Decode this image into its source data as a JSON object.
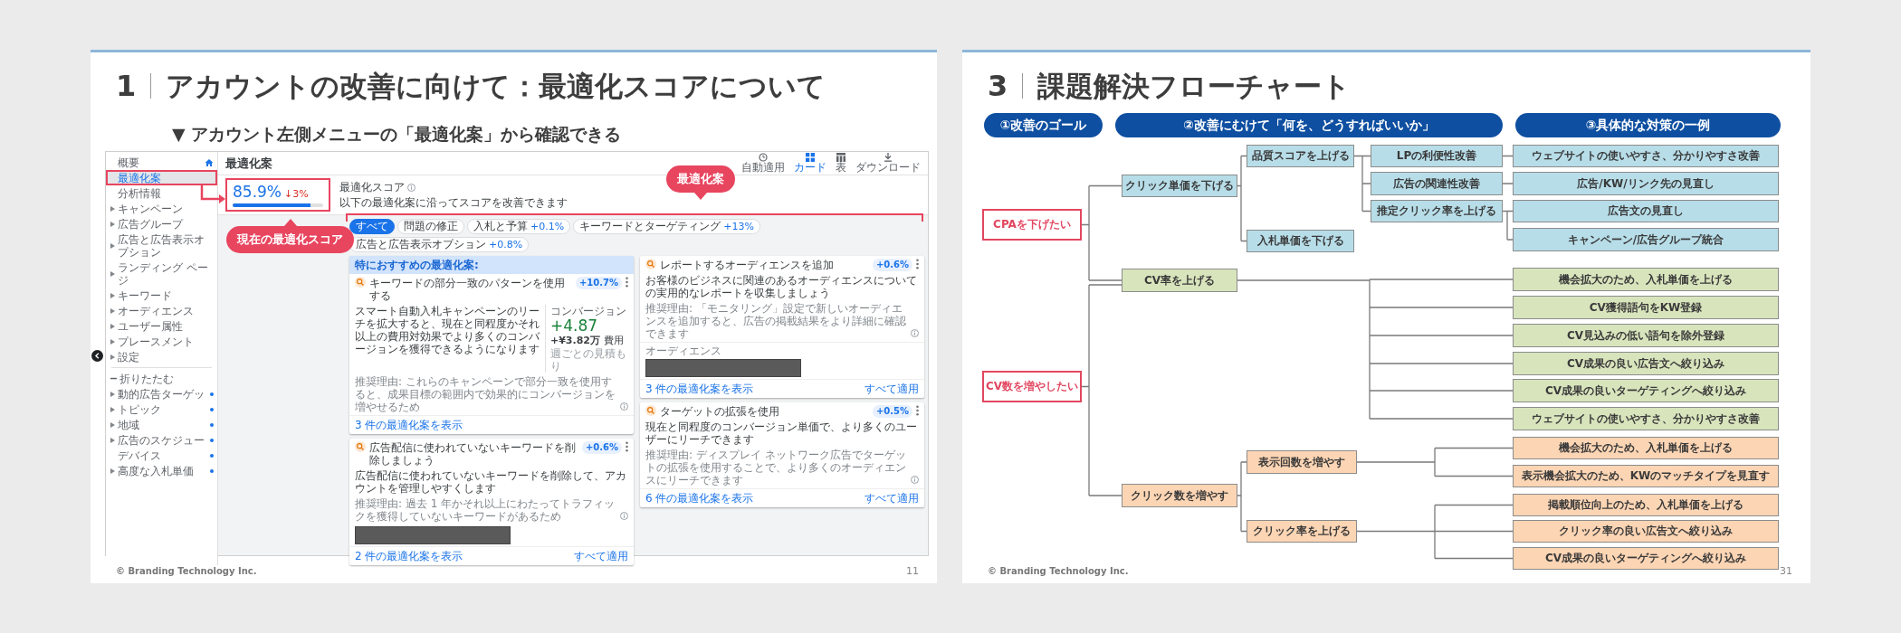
{
  "slides": [
    {
      "kind": "screenshot",
      "number": "1",
      "title": "アカウントの改善に向けて：最適化スコアについて",
      "subtitle": "▼ アカウント左側メニューの「最適化案」から確認できる",
      "screen": {
        "sidebar": [
          {
            "kind": "link",
            "label": "概要",
            "selected": false,
            "expandable": false,
            "flagged": false
          },
          {
            "kind": "link",
            "label": "最適化案",
            "selected": true,
            "expandable": false,
            "flagged": false
          },
          {
            "kind": "link",
            "label": "分析情報",
            "selected": false,
            "expandable": false,
            "flagged": false
          },
          {
            "kind": "link",
            "label": "キャンペーン",
            "selected": false,
            "expandable": true,
            "flagged": false
          },
          {
            "kind": "link",
            "label": "広告グループ",
            "selected": false,
            "expandable": true,
            "flagged": false
          },
          {
            "kind": "link",
            "label": "広告と広告表示オプション",
            "selected": false,
            "expandable": true,
            "flagged": false
          },
          {
            "kind": "link",
            "label": "ランディング ページ",
            "selected": false,
            "expandable": true,
            "flagged": false
          },
          {
            "kind": "link",
            "label": "キーワード",
            "selected": false,
            "expandable": true,
            "flagged": false
          },
          {
            "kind": "link",
            "label": "オーディエンス",
            "selected": false,
            "expandable": true,
            "flagged": false
          },
          {
            "kind": "link",
            "label": "ユーザー属性",
            "selected": false,
            "expandable": true,
            "flagged": false
          },
          {
            "kind": "link",
            "label": "プレースメント",
            "selected": false,
            "expandable": true,
            "flagged": false
          },
          {
            "kind": "link",
            "label": "設定",
            "selected": false,
            "expandable": true,
            "flagged": false
          },
          {
            "kind": "collapse",
            "label": "折りたたむ",
            "selected": false
          },
          {
            "kind": "link",
            "label": "動的広告ターゲッ",
            "selected": false,
            "expandable": true,
            "flagged": true
          },
          {
            "kind": "link",
            "label": "トピック",
            "selected": false,
            "expandable": true,
            "flagged": true
          },
          {
            "kind": "link",
            "label": "地域",
            "selected": false,
            "expandable": true,
            "flagged": true
          },
          {
            "kind": "link",
            "label": "広告のスケジュー",
            "selected": false,
            "expandable": true,
            "flagged": true
          },
          {
            "kind": "link",
            "label": "デバイス",
            "selected": false,
            "expandable": false,
            "flagged": true
          },
          {
            "kind": "link",
            "label": "高度な入札単価",
            "selected": false,
            "expandable": true,
            "flagged": true
          }
        ],
        "header": {
          "title": "最適化案",
          "tools": [
            {
              "label": "自動適用",
              "selected": false
            },
            {
              "label": "カード",
              "selected": true
            },
            {
              "label": "表",
              "selected": false
            },
            {
              "label": "ダウンロード",
              "selected": false
            }
          ]
        },
        "score": {
          "value": "85.9%",
          "change": "↓3%",
          "level": 0.86,
          "label": "最適化スコア",
          "description": "以下の最適化案に沿ってスコアを改善できます"
        },
        "filters": [
          {
            "label": "すべて",
            "selected": true
          },
          {
            "label": "問題の修正",
            "selected": false
          },
          {
            "label": "入札と予算",
            "delta": "+0.1%",
            "selected": false
          },
          {
            "label": "キーワードとターゲティング",
            "delta": "+13%",
            "selected": false
          },
          {
            "label": "広告と広告表示オプション",
            "delta": "+0.8%",
            "selected": false
          }
        ],
        "columns": [
          [
            {
              "banner": "特におすすめの最適化案:",
              "title": "キーワードの部分一致のパターンを使用する",
              "badge": "+10.7%",
              "body": "スマート自動入札キャンペーンのリーチを拡大すると、現在と同程度かそれ以上の費用対効果でより多くのコンバージョンを獲得できるようになります",
              "metric": {
                "label": "コンバージョン",
                "value": "+4.87",
                "cost": "**+¥3.82万** 費用",
                "note": "週ごとの見積もり"
              },
              "reason": "推奨理由: これらのキャンペーンで部分一致を使用すると、成果目標の範囲内で効果的にコンバージョンを増やせるため",
              "link": "3 件の最適化案を表示"
            },
            {
              "title": "広告配信に使われていないキーワードを削除しましょう",
              "badge": "+0.6%",
              "body": "広告配信に使われていないキーワードを削除して、アカウントを管理しやすくします",
              "reason": "推奨理由: 過去 1 年かそれ以上にわたってトラフィックを獲得していないキーワードがあるため",
              "redacted": true,
              "link": "2 件の最適化案を表示",
              "apply": "すべて適用"
            }
          ],
          [
            {
              "title": "レポートするオーディエンスを追加",
              "badge": "+0.6%",
              "body": "お客様のビジネスに関連のあるオーディエンスについての実用的なレポートを収集しましょう",
              "reason": "推奨理由: 「モニタリング」設定で新しいオーディエンスを追加すると、広告の掲載結果をより詳細に確認できます",
              "section": "オーディエンス",
              "redacted": true,
              "link": "3 件の最適化案を表示",
              "apply": "すべて適用"
            },
            {
              "title": "ターゲットの拡張を使用",
              "badge": "+0.5%",
              "body": "現在と同程度のコンバージョン単価で、より多くのユーザーにリーチできます",
              "reason": "推奨理由: ディスプレイ ネットワーク広告でターゲットの拡張を使用することで、より多くのオーディエンスにリーチできます",
              "link": "6 件の最適化案を表示",
              "apply": "すべて適用"
            }
          ]
        ]
      },
      "callouts": [
        "現在の最適化スコア",
        "最適化案"
      ],
      "footer": "© Branding Technology Inc.",
      "page": "11"
    },
    {
      "kind": "flowchart",
      "number": "3",
      "title": "課題解決フローチャート",
      "headers": [
        "①改善のゴール",
        "②改善にむけて「何を、どうすればいいか」",
        "③具体的な対策の一例"
      ],
      "goals": [
        {
          "label": "CPAを下げたい",
          "joins_shared_branch": false,
          "children": [
            {
              "label": "クリック単価を下げる",
              "color": "#b7dde8",
              "children": [
                {
                  "label": "品質スコアを上げる",
                  "children": [
                    {
                      "label": "LPの利便性改善",
                      "children": [
                        {
                          "label": "ウェブサイトの使いやすさ、分かりやすさ改善"
                        }
                      ]
                    },
                    {
                      "label": "広告の関連性改善",
                      "children": [
                        {
                          "label": "広告/KW/リンク先の見直し"
                        }
                      ]
                    },
                    {
                      "label": "推定クリック率を上げる",
                      "children": [
                        {
                          "label": "広告文の見直し"
                        },
                        {
                          "label": "キャンペーン/広告グループ統合"
                        }
                      ]
                    }
                  ]
                },
                {
                  "label": "入札単価を下げる"
                }
              ]
            },
            {
              "label": "CV率を上げる",
              "color": "#d8e4bc",
              "children": [
                {
                  "label": "機会拡大のため、入札単価を上げる"
                },
                {
                  "label": "CV獲得語句をKW登録"
                },
                {
                  "label": "CV見込みの低い語句を除外登録"
                },
                {
                  "label": "CV成果の良い広告文へ絞り込み"
                },
                {
                  "label": "CV成果の良いターゲティングへ絞り込み"
                },
                {
                  "label": "ウェブサイトの使いやすさ、分かりやすさ改善"
                }
              ]
            }
          ]
        },
        {
          "label": "CV数を増やしたい",
          "joins_shared_branch": true,
          "children": [
            {
              "label": "クリック数を増やす",
              "color": "#fcd5b4",
              "children": [
                {
                  "label": "表示回数を増やす",
                  "children": [
                    {
                      "label": "機会拡大のため、入札単価を上げる"
                    },
                    {
                      "label": "表示機会拡大のため、KWのマッチタイプを見直す"
                    }
                  ]
                },
                {
                  "label": "クリック率を上げる",
                  "children": [
                    {
                      "label": "掲載順位向上のため、入札単価を上げる"
                    },
                    {
                      "label": "クリック率の良い広告文へ絞り込み"
                    },
                    {
                      "label": "CV成果の良いターゲティングへ絞り込み"
                    }
                  ]
                }
              ]
            }
          ]
        }
      ],
      "footer": "© Branding Technology Inc.",
      "page": "31"
    }
  ]
}
